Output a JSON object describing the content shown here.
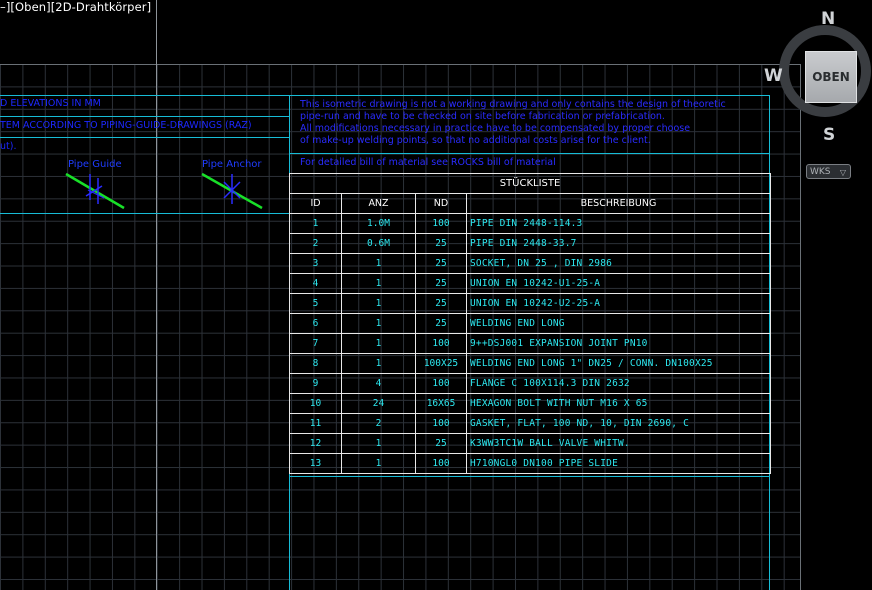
{
  "viewport": {
    "label": "–][Oben][2D-Drahtkörper]"
  },
  "header_left": {
    "line1": "D ELEVATIONS IN MM",
    "line2": "TEM ACCORDING TO PIPING-GUIDE-DRAWINGS (RAZ)",
    "line3": "ut)."
  },
  "symbols": {
    "pipe_guide": "Pipe Guide",
    "pipe_anchor": "Pipe Anchor"
  },
  "note": {
    "lines": [
      "This isometric drawing is not a working drawing and only contains the design of theoretic",
      "pipe-run and have to be checked on site before fabrication or prefabrication.",
      "All modifications necessary in practice have to be compensated by proper choose",
      "of make-up welding points, so that no additional costs arise for the client."
    ],
    "bom_ref": "For detailed bill of material see ROCKS bill of material"
  },
  "bom": {
    "title": "STÜCKLISTE",
    "columns": [
      "ID",
      "ANZ",
      "ND",
      "BESCHREIBUNG"
    ],
    "rows": [
      [
        "1",
        "1.0M",
        "100",
        "PIPE DIN 2448-114.3"
      ],
      [
        "2",
        "0.6M",
        "25",
        "PIPE DIN 2448-33.7"
      ],
      [
        "3",
        "1",
        "25",
        "SOCKET, DN 25 , DIN 2986"
      ],
      [
        "4",
        "1",
        "25",
        "UNION EN 10242-U1-25-A"
      ],
      [
        "5",
        "1",
        "25",
        "UNION EN 10242-U2-25-A"
      ],
      [
        "6",
        "1",
        "25",
        "WELDING END LONG"
      ],
      [
        "7",
        "1",
        "100",
        "9++DSJ001 EXPANSION JOINT PN10"
      ],
      [
        "8",
        "1",
        "100X25",
        "WELDING END LONG 1\" DN25 / CONN. DN100X25"
      ],
      [
        "9",
        "4",
        "100",
        "FLANGE C 100X114.3 DIN 2632"
      ],
      [
        "10",
        "24",
        "16X65",
        "HEXAGON BOLT WITH NUT M16 X 65"
      ],
      [
        "11",
        "2",
        "100",
        "GASKET, FLAT, 100 ND, 10, DIN 2690, C"
      ],
      [
        "12",
        "1",
        "25",
        "K3WW3TC1W BALL VALVE WHITW."
      ],
      [
        "13",
        "1",
        "100",
        "H710NGL0 DN100 PIPE SLIDE"
      ]
    ]
  },
  "viewcube": {
    "north": "N",
    "west": "W",
    "south": "S",
    "face": "OBEN",
    "wcs": "WKS"
  },
  "icons": {
    "pipe_guide": "pipe-guide-symbol-icon",
    "pipe_anchor": "pipe-anchor-symbol-icon",
    "wcs_dropdown": "chevron-down-icon"
  },
  "colors": {
    "background": "#000000",
    "frame": "#17bcd6",
    "note_text": "#2a2cff",
    "table_text": "#2de8f0",
    "symbol_line": "#18e028"
  }
}
